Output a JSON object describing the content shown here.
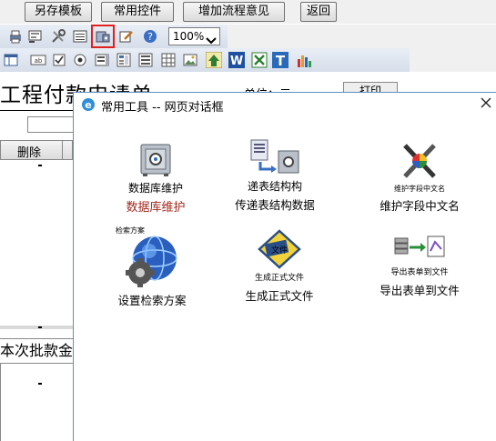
{
  "topbar": {
    "buttons": [
      "另存模板",
      "常用控件",
      "增加流程意见",
      "返回"
    ]
  },
  "toolbar": {
    "zoom_value": "100%",
    "icons_row1": [
      "print-icon",
      "preview-icon",
      "tools-icon",
      "list-icon",
      "database-icon",
      "edit-icon",
      "help-icon"
    ],
    "icons_row2": [
      "table-icon",
      "textbox-icon",
      "checkbox-icon",
      "radio-icon",
      "list-box-icon",
      "grid-icon",
      "form-icon",
      "image-icon",
      "home-icon",
      "word-icon",
      "excel-icon",
      "text-icon",
      "chart-icon"
    ]
  },
  "document": {
    "title": "工程付款申请单",
    "right_label": "单位：元",
    "right_button": "打印",
    "column_header": "删除",
    "amount_label": "本次批款金额"
  },
  "dialog": {
    "title": "常用工具 -- 网页对话框",
    "tools": [
      {
        "icon_caption": "数据库维护",
        "caption": "数据库维护"
      },
      {
        "icon_caption": "递表结构构",
        "caption": "传递表结构数据"
      },
      {
        "icon_caption": "维护字段中文名",
        "caption": "维护字段中文名"
      },
      {
        "icon_caption": "检索方案",
        "caption": "设置检索方案"
      },
      {
        "icon_caption": "生成正式文件",
        "caption": "生成正式文件"
      },
      {
        "icon_caption": "导出表单到文件",
        "caption": "导出表单到文件"
      }
    ],
    "file_badge": "文件"
  },
  "colors": {
    "accent_red": "#a0281e",
    "toolbar_blue": "#d6deea",
    "highlight_red": "#e02020"
  }
}
